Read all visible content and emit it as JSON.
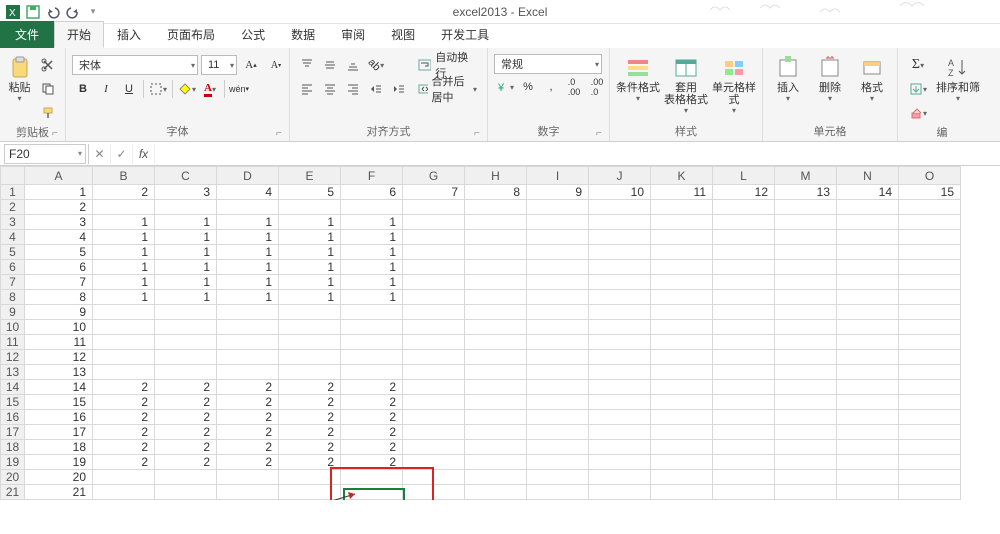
{
  "title": "excel2013 - Excel",
  "ribbonTabs": {
    "file": "文件",
    "home": "开始",
    "insert": "插入",
    "layout": "页面布局",
    "formulas": "公式",
    "data": "数据",
    "review": "审阅",
    "view": "视图",
    "dev": "开发工具"
  },
  "groups": {
    "clipboard": {
      "paste": "粘贴",
      "label": "剪贴板"
    },
    "font": {
      "name": "宋体",
      "size": "11",
      "label": "字体",
      "bold": "B",
      "italic": "I",
      "underline": "U"
    },
    "align": {
      "wrap": "自动换行",
      "merge": "合并后居中",
      "label": "对齐方式"
    },
    "number": {
      "format": "常规",
      "percent": "%",
      "comma": ",",
      "label": "数字"
    },
    "styles": {
      "cond": "条件格式",
      "table": "套用\n表格格式",
      "cell": "单元格样式",
      "label": "样式"
    },
    "cells": {
      "insert": "插入",
      "delete": "删除",
      "format": "格式",
      "label": "单元格"
    },
    "editing": {
      "sort": "排序和筛",
      "label": "编"
    }
  },
  "nameBox": "F20",
  "formula": "",
  "columns": [
    "A",
    "B",
    "C",
    "D",
    "E",
    "F",
    "G",
    "H",
    "I",
    "J",
    "K",
    "L",
    "M",
    "N",
    "O"
  ],
  "rows": [
    1,
    2,
    3,
    4,
    5,
    6,
    7,
    8,
    9,
    10,
    11,
    12,
    13,
    14,
    15,
    16,
    17,
    18,
    19,
    20,
    21
  ],
  "cells": {
    "r1": {
      "A": "1",
      "B": "2",
      "C": "3",
      "D": "4",
      "E": "5",
      "F": "6",
      "G": "7",
      "H": "8",
      "I": "9",
      "J": "10",
      "K": "11",
      "L": "12",
      "M": "13",
      "N": "14",
      "O": "15"
    },
    "r2": {
      "A": "2"
    },
    "r3": {
      "A": "3",
      "B": "1",
      "C": "1",
      "D": "1",
      "E": "1",
      "F": "1"
    },
    "r4": {
      "A": "4",
      "B": "1",
      "C": "1",
      "D": "1",
      "E": "1",
      "F": "1"
    },
    "r5": {
      "A": "5",
      "B": "1",
      "C": "1",
      "D": "1",
      "E": "1",
      "F": "1"
    },
    "r6": {
      "A": "6",
      "B": "1",
      "C": "1",
      "D": "1",
      "E": "1",
      "F": "1"
    },
    "r7": {
      "A": "7",
      "B": "1",
      "C": "1",
      "D": "1",
      "E": "1",
      "F": "1"
    },
    "r8": {
      "A": "8",
      "B": "1",
      "C": "1",
      "D": "1",
      "E": "1",
      "F": "1"
    },
    "r9": {
      "A": "9"
    },
    "r10": {
      "A": "10"
    },
    "r11": {
      "A": "11"
    },
    "r12": {
      "A": "12"
    },
    "r13": {
      "A": "13"
    },
    "r14": {
      "A": "14",
      "B": "2",
      "C": "2",
      "D": "2",
      "E": "2",
      "F": "2"
    },
    "r15": {
      "A": "15",
      "B": "2",
      "C": "2",
      "D": "2",
      "E": "2",
      "F": "2"
    },
    "r16": {
      "A": "16",
      "B": "2",
      "C": "2",
      "D": "2",
      "E": "2",
      "F": "2"
    },
    "r17": {
      "A": "17",
      "B": "2",
      "C": "2",
      "D": "2",
      "E": "2",
      "F": "2"
    },
    "r18": {
      "A": "18",
      "B": "2",
      "C": "2",
      "D": "2",
      "E": "2",
      "F": "2"
    },
    "r19": {
      "A": "19",
      "B": "2",
      "C": "2",
      "D": "2",
      "E": "2",
      "F": "2"
    },
    "r20": {
      "A": "20"
    },
    "r21": {
      "A": "21"
    }
  },
  "activeCell": "F20",
  "highlight": {
    "row": 20,
    "colStart": "E",
    "colEnd": "F",
    "extraCol": "F_above"
  }
}
